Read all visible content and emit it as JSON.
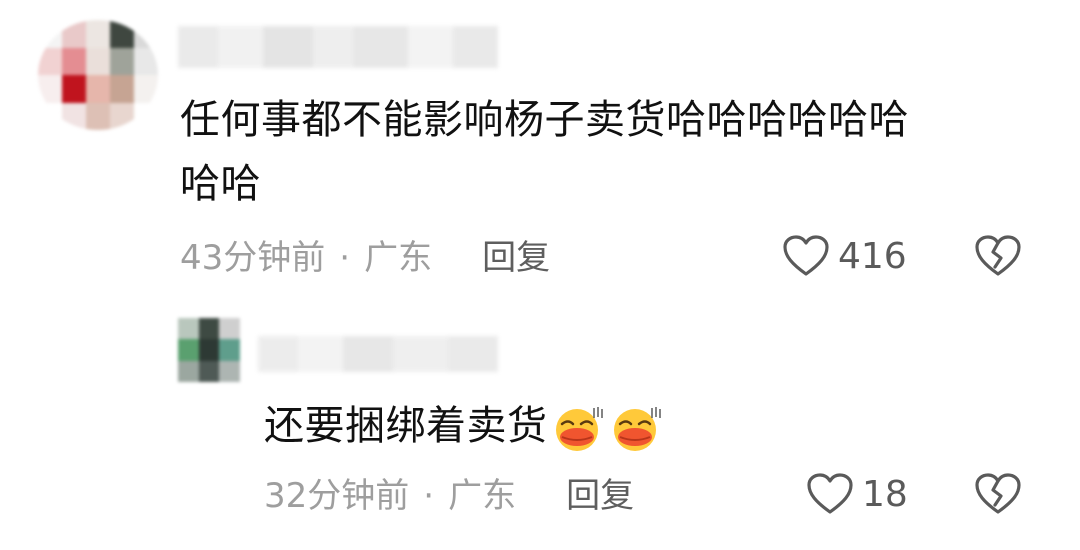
{
  "comments": [
    {
      "text_line1": "任何事都不能影响杨子卖货哈哈哈哈哈哈",
      "text_line2": "哈哈",
      "time": "43分钟前",
      "separator": "·",
      "location": "广东",
      "reply_label": "回复",
      "likes": "416"
    },
    {
      "text": "还要捆绑着卖货",
      "time": "32分钟前",
      "separator": "·",
      "location": "广东",
      "reply_label": "回复",
      "likes": "18",
      "emojis": [
        "kiss-laugh-emoji",
        "kiss-laugh-emoji"
      ]
    }
  ],
  "icons": {
    "like": "heart-outline-icon",
    "dislike": "broken-heart-icon"
  },
  "colors": {
    "text": "#111111",
    "meta": "#9e9e9e",
    "reply": "#5e5e5e",
    "icon": "#5a5a5a"
  }
}
